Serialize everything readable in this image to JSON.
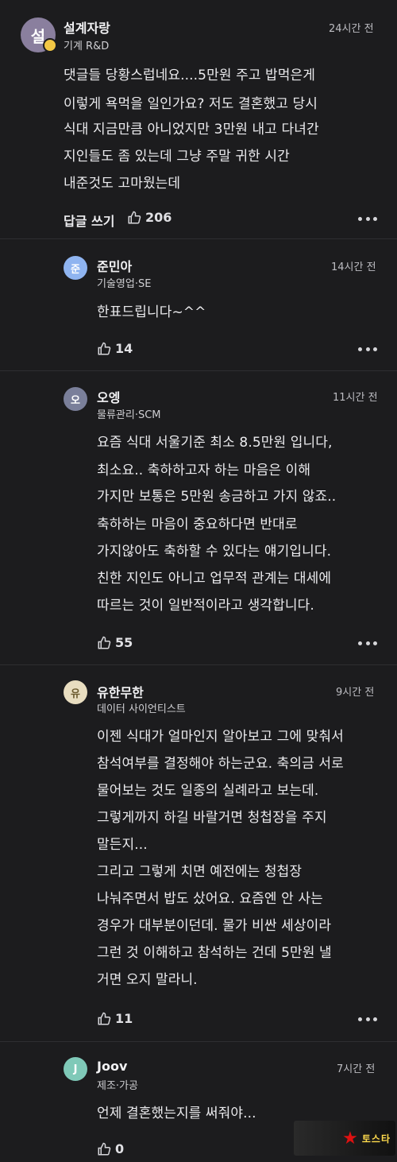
{
  "main_comment": {
    "avatar_text": "설",
    "author": "설계자랑",
    "dept": "기계 R&D",
    "time": "24시간 전",
    "lines": [
      "댓글들 당황스럽네요....5만원 주고 밥먹은게",
      "이렇게 욕먹을 일인가요? 저도 결혼했고 당시",
      "식대 지금만큼 아니었지만 3만원 내고 다녀간",
      "지인들도 좀 있는데 그냥 주말 귀한 시간",
      "내준것도 고마웠는데"
    ],
    "reply_label": "답글 쓰기",
    "likes": "206"
  },
  "replies": [
    {
      "avatar_text": "준",
      "author": "준민아",
      "dept": "기술영업·SE",
      "time": "14시간 전",
      "lines": [
        "한표드립니다~^^"
      ],
      "likes": "14"
    },
    {
      "avatar_text": "오",
      "author": "오엥",
      "dept": "물류관리·SCM",
      "time": "11시간 전",
      "lines": [
        "요즘 식대 서울기준 최소 8.5만원 입니다,",
        "최소요.. 축하하고자 하는 마음은 이해",
        "가지만 보통은 5만원 송금하고 가지 않죠..",
        "축하하는 마음이 중요하다면 반대로",
        "가지않아도 축하할 수 있다는 얘기입니다.",
        "친한 지인도 아니고 업무적 관계는 대세에",
        "따르는 것이 일반적이라고 생각합니다."
      ],
      "likes": "55"
    },
    {
      "avatar_text": "유",
      "author": "유한무한",
      "dept": "데이터 사이언티스트",
      "time": "9시간 전",
      "lines": [
        "이젠 식대가 얼마인지 알아보고 그에 맞춰서",
        "참석여부를 결정해야 하는군요. 축의금 서로",
        "물어보는 것도 일종의 실례라고 보는데.",
        "그렇게까지 하길 바랄거면 청첩장을 주지",
        "말든지...",
        "그리고 그렇게 치면 예전에는 청첩장",
        "나눠주면서 밥도 샀어요. 요즘엔 안 사는",
        "경우가 대부분이던데. 물가 비싼 세상이라",
        "그런 것 이해하고 참석하는 건데 5만원 낼",
        "거면 오지 말라니."
      ],
      "likes": "11"
    },
    {
      "avatar_text": "J",
      "author": "Joov",
      "dept": "제조·가공",
      "time": "7시간 전",
      "lines": [
        "언제 결혼했는지를 써줘야..."
      ],
      "likes": "0"
    }
  ],
  "watermark": "토스타",
  "colors": {
    "background": "#1c1c1e",
    "avatar_main": "#8a7f9e",
    "avatar_jun": "#8fb4f0",
    "avatar_oh": "#7a7f9a",
    "avatar_yu": "#e8ddc0",
    "avatar_j": "#7fc9b8"
  }
}
